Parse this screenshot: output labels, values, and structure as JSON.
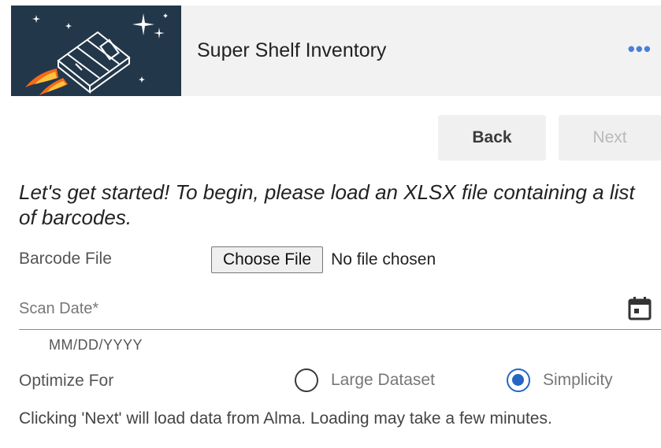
{
  "header": {
    "app_title": "Super Shelf Inventory",
    "menu_icon": "more-horizontal-icon",
    "menu_label": "•••"
  },
  "nav": {
    "back_label": "Back",
    "next_label": "Next",
    "next_enabled": false
  },
  "intro": {
    "text": "Let's get started! To begin, please load an XLSX file containing a list of barcodes."
  },
  "barcode_file": {
    "label": "Barcode File",
    "button_label": "Choose File",
    "status": "No file chosen"
  },
  "scan_date": {
    "placeholder": "Scan Date*",
    "value": "",
    "hint": "MM/DD/YYYY",
    "icon": "calendar-icon"
  },
  "optimize": {
    "label": "Optimize For",
    "options": [
      {
        "label": "Large Dataset",
        "checked": false
      },
      {
        "label": "Simplicity",
        "checked": true
      }
    ]
  },
  "note": {
    "text": "Clicking 'Next' will load data from Alma. Loading may take a few minutes."
  },
  "colors": {
    "accent": "#2566c4",
    "logo_bg": "#23374a",
    "header_bg": "#f2f2f2"
  }
}
